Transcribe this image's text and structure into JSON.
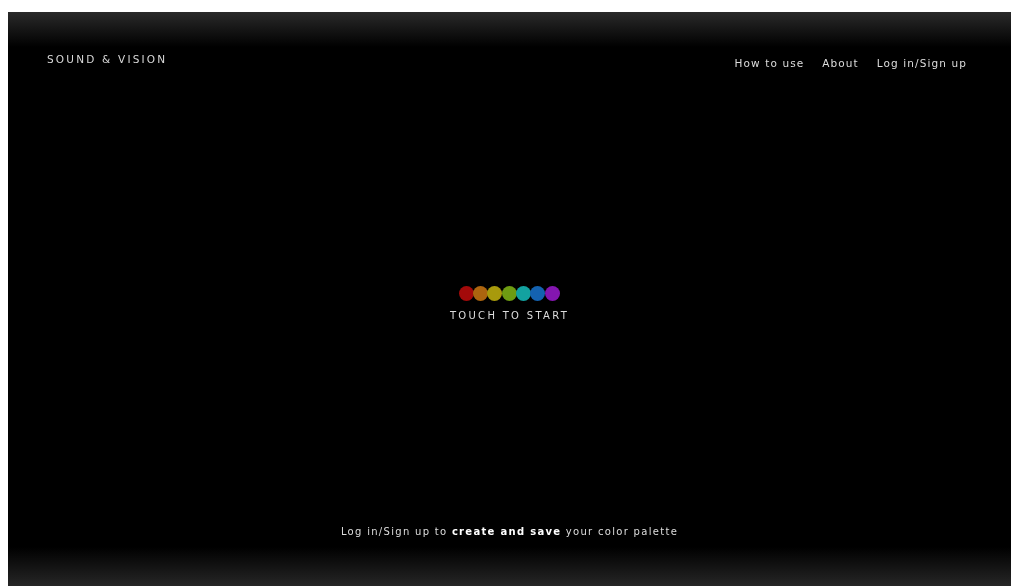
{
  "brand": "SOUND & VISION",
  "nav": [
    {
      "label": "How to use"
    },
    {
      "label": "About"
    },
    {
      "label": "Log in/Sign up"
    }
  ],
  "dots": [
    {
      "color": "#a30a0a"
    },
    {
      "color": "#ad650f"
    },
    {
      "color": "#a89a0c"
    },
    {
      "color": "#6e9c12"
    },
    {
      "color": "#13a2a0"
    },
    {
      "color": "#1462b0"
    },
    {
      "color": "#8416b0"
    }
  ],
  "start_label": "TOUCH TO START",
  "footer_text": "Log in/Sign up to **create and save** your color palette"
}
